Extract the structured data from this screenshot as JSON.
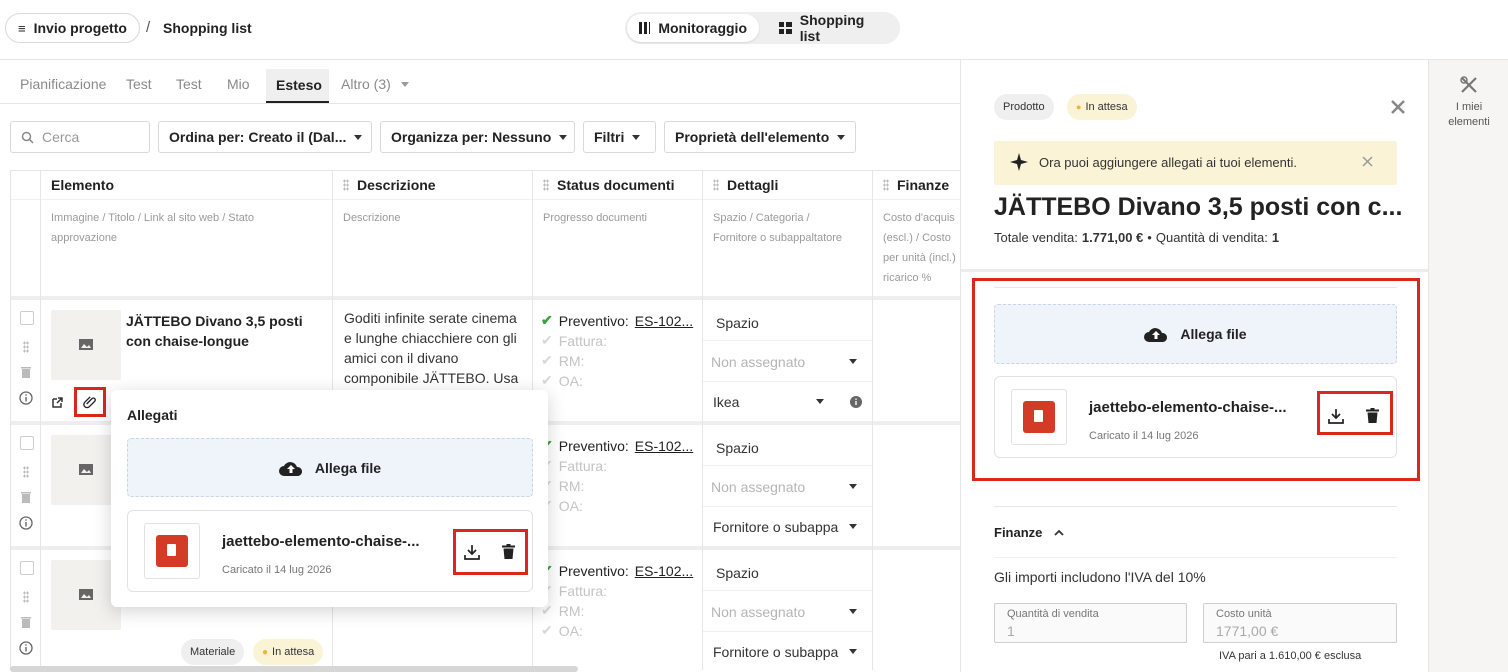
{
  "topbar": {
    "project_button": "Invio progetto",
    "separator": "/",
    "breadcrumb_current": "Shopping list",
    "toggle": [
      {
        "label": "Monitoraggio"
      },
      {
        "label": "Shopping list"
      }
    ]
  },
  "tabs": [
    "Pianificazione",
    "Test",
    "Test",
    "Mio",
    "Esteso",
    "Altro (3)"
  ],
  "toolbar": {
    "search_placeholder": "Cerca",
    "sort": "Ordina per: Creato il (Dal...",
    "organize": "Organizza per: Nessuno",
    "filters": "Filtri",
    "properties": "Proprietà dell'elemento"
  },
  "columns": {
    "element": {
      "title": "Elemento",
      "sub1": "Immagine / Titolo / Link al sito web / Stato",
      "sub2": "approvazione"
    },
    "description": {
      "title": "Descrizione",
      "sub1": "Descrizione"
    },
    "status": {
      "title": "Status documenti",
      "sub1": "Progresso documenti"
    },
    "details": {
      "title": "Dettagli",
      "sub1": "Spazio / Categoria /",
      "sub2": "Fornitore o subappaltatore"
    },
    "finance": {
      "title": "Finanze",
      "sub1": "Costo d'acquis",
      "sub2": "(escl.) / Costo",
      "sub3": "per unità (incl.)",
      "sub4": "ricarico %"
    }
  },
  "rows": [
    {
      "title_line1": "JÄTTEBO Divano 3,5 posti",
      "title_line2": "con chaise-longue",
      "desc": [
        "Goditi infinite serate cinema",
        "e lunghe chiacchiere con gli",
        "amici con il divano",
        "componibile JÄTTEBO. Usa"
      ],
      "docs": {
        "quote_label": "Preventivo:",
        "quote_link": "ES-102...",
        "invoice": "Fattura:",
        "rm": "RM:",
        "oa": "OA:"
      },
      "space": "Spazio",
      "category": "Non assegnato",
      "supplier": "Ikea"
    },
    {
      "docs": {
        "quote_label": "Preventivo:",
        "quote_link": "ES-102...",
        "invoice": "Fattura:",
        "rm": "RM:",
        "oa": "OA:"
      },
      "space": "Spazio",
      "category": "Non assegnato",
      "supplier": "Fornitore o subappa"
    },
    {
      "docs": {
        "quote_label": "Preventivo:",
        "quote_link": "ES-102...",
        "invoice": "Fattura:",
        "rm": "RM:",
        "oa": "OA:"
      },
      "space": "Spazio",
      "category": "Non assegnato",
      "supplier": "Fornitore o subappa",
      "chips": {
        "material": "Materiale",
        "pending": "In attesa"
      }
    }
  ],
  "popover": {
    "title": "Allegati",
    "upload_label": "Allega file",
    "file_name": "jaettebo-elemento-chaise-...",
    "file_date": "Caricato il 14 lug 2026"
  },
  "panel": {
    "chip_product": "Prodotto",
    "chip_status": "In attesa",
    "banner_text": "Ora puoi aggiungere allegati ai tuoi elementi.",
    "title": "JÄTTEBO Divano 3,5 posti con c...",
    "total_label": "Totale vendita:",
    "total_value": "1.771,00 €",
    "bullet": "•",
    "qty_label": "Quantità di vendita:",
    "qty_value": "1",
    "upload_label": "Allega file",
    "file_name": "jaettebo-elemento-chaise-...",
    "file_date": "Caricato il 14 lug 2026",
    "finance_title": "Finanze",
    "vat_note": "Gli importi includono l'IVA del 10%",
    "field_qty_label": "Quantità di vendita",
    "field_qty_value": "1",
    "field_cost_label": "Costo unità",
    "field_cost_value": "1771,00 €",
    "vat_footer": "IVA pari a 1.610,00 € esclusa"
  },
  "right_strip": {
    "label_line1": "I miei",
    "label_line2": "elementi"
  },
  "colors": {
    "accent_red": "#d8281c",
    "pending_dot": "#f2b233",
    "banner_bg": "#fbf3d6",
    "upload_bg": "#eff4fa",
    "check_green": "#3aa142"
  }
}
